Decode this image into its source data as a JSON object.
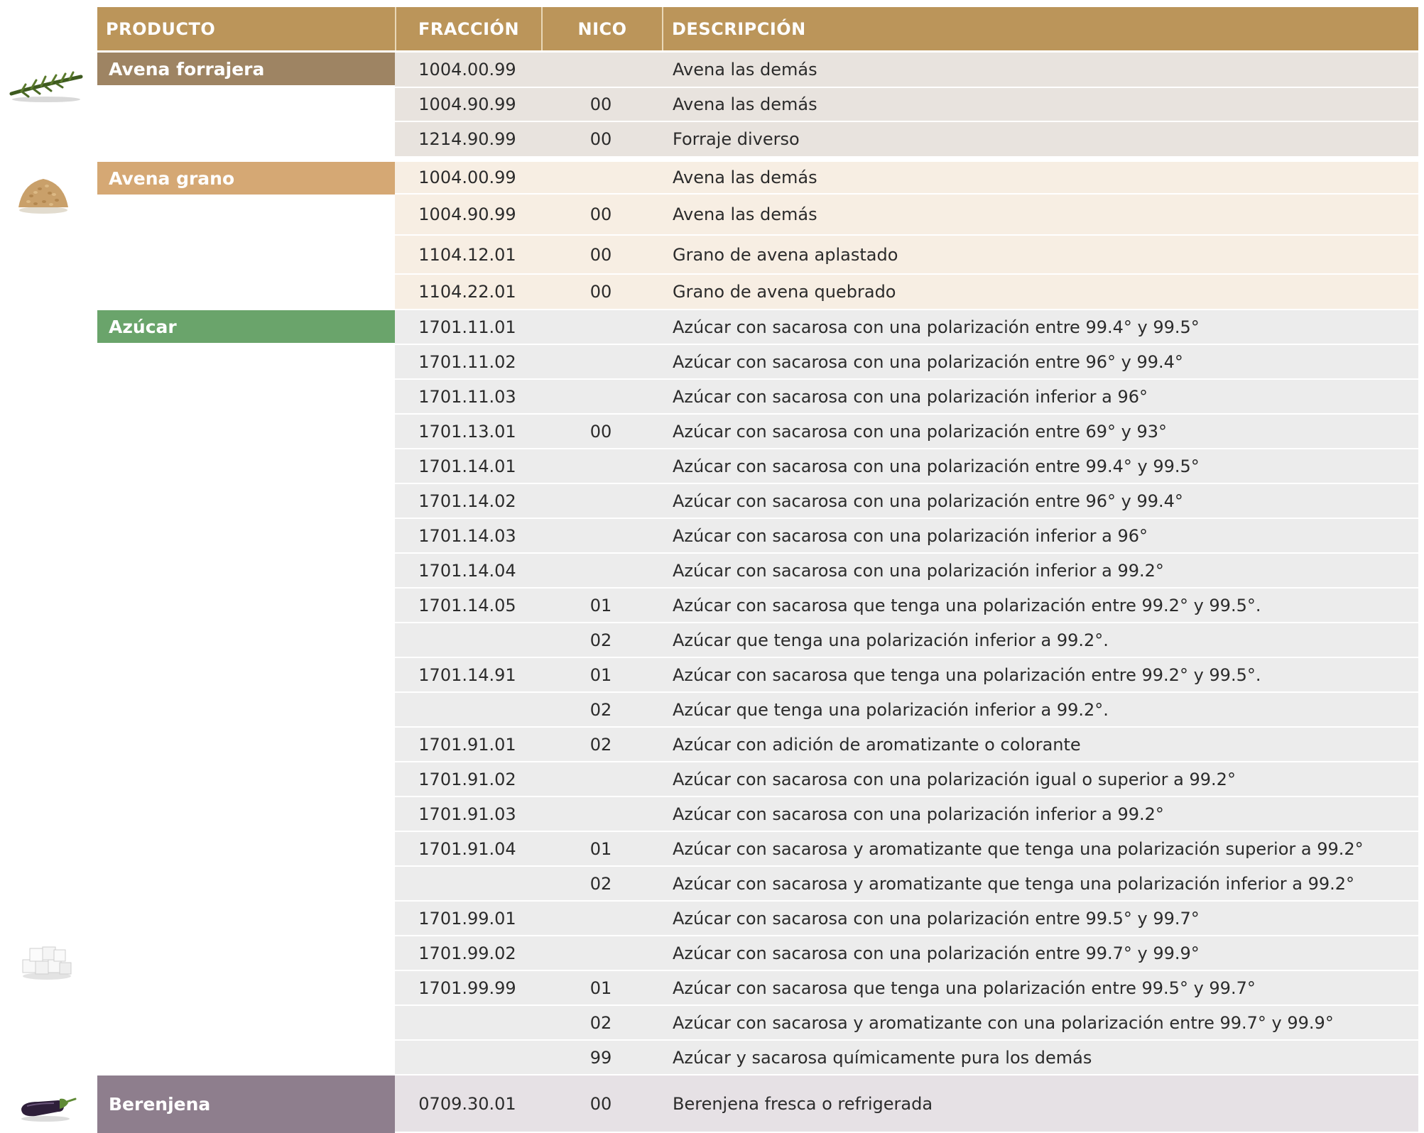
{
  "header": {
    "producto": "PRODUCTO",
    "fraccion": "FRACCIÓN",
    "nico": "NICO",
    "descripcion": "DESCRIPCIÓN"
  },
  "colors": {
    "header": "#bb955a",
    "avena_forrajera_label": "#9e8463",
    "avena_forrajera_rows": "#e8e3de",
    "avena_grano_label": "#d5a874",
    "avena_grano_rows": "#f7eee3",
    "azucar_label": "#6aa46b",
    "azucar_rows": "#ececec",
    "berenjena_label": "#8e7e8d",
    "berenjena_rows": "#e6e1e5"
  },
  "products": [
    {
      "name": "Avena forrajera",
      "icon": "forage-oat-icon",
      "rows": [
        {
          "fraccion": "1004.00.99",
          "nico": "",
          "descripcion": "Avena las demás"
        },
        {
          "fraccion": "1004.90.99",
          "nico": "00",
          "descripcion": "Avena las demás"
        },
        {
          "fraccion": "1214.90.99",
          "nico": "00",
          "descripcion": "Forraje diverso"
        }
      ]
    },
    {
      "name": "Avena grano",
      "icon": "oat-grain-icon",
      "rows": [
        {
          "fraccion": "1004.00.99",
          "nico": "",
          "descripcion": "Avena las demás"
        },
        {
          "fraccion": "1004.90.99",
          "nico": "00",
          "descripcion": "Avena las demás"
        },
        {
          "fraccion": "1104.12.01",
          "nico": "00",
          "descripcion": "Grano de avena aplastado"
        },
        {
          "fraccion": "1104.22.01",
          "nico": "00",
          "descripcion": "Grano de avena quebrado"
        }
      ]
    },
    {
      "name": "Azúcar",
      "icon": "sugar-cubes-icon",
      "rows": [
        {
          "fraccion": "1701.11.01",
          "nico": "",
          "descripcion": "Azúcar con sacarosa con una polarización entre 99.4° y 99.5°"
        },
        {
          "fraccion": "1701.11.02",
          "nico": "",
          "descripcion": "Azúcar con sacarosa con una polarización entre 96° y 99.4°"
        },
        {
          "fraccion": "1701.11.03",
          "nico": "",
          "descripcion": "Azúcar con sacarosa con una polarización inferior a 96°"
        },
        {
          "fraccion": "1701.13.01",
          "nico": "00",
          "descripcion": "Azúcar con sacarosa con una polarización entre 69° y 93°"
        },
        {
          "fraccion": "1701.14.01",
          "nico": "",
          "descripcion": "Azúcar con sacarosa con una polarización entre 99.4° y 99.5°"
        },
        {
          "fraccion": "1701.14.02",
          "nico": "",
          "descripcion": "Azúcar con sacarosa con una polarización entre 96° y 99.4°"
        },
        {
          "fraccion": "1701.14.03",
          "nico": "",
          "descripcion": "Azúcar con sacarosa con una polarización inferior a 96°"
        },
        {
          "fraccion": "1701.14.04",
          "nico": "",
          "descripcion": "Azúcar con sacarosa con una polarización inferior a 99.2°"
        },
        {
          "fraccion": "1701.14.05",
          "nico": "01",
          "descripcion": "Azúcar con sacarosa que tenga una polarización entre 99.2° y 99.5°."
        },
        {
          "fraccion": "",
          "nico": "02",
          "descripcion": "Azúcar que tenga una polarización inferior a 99.2°."
        },
        {
          "fraccion": "1701.14.91",
          "nico": "01",
          "descripcion": "Azúcar con sacarosa que tenga una polarización entre 99.2° y 99.5°."
        },
        {
          "fraccion": "",
          "nico": "02",
          "descripcion": "Azúcar que tenga una polarización inferior a 99.2°."
        },
        {
          "fraccion": "1701.91.01",
          "nico": "02",
          "descripcion": "Azúcar con adición de aromatizante o colorante"
        },
        {
          "fraccion": "1701.91.02",
          "nico": "",
          "descripcion": "Azúcar con sacarosa con una polarización igual o superior a 99.2°"
        },
        {
          "fraccion": "1701.91.03",
          "nico": "",
          "descripcion": "Azúcar con sacarosa con una polarización inferior a 99.2°"
        },
        {
          "fraccion": "1701.91.04",
          "nico": "01",
          "descripcion": "Azúcar con sacarosa y aromatizante que tenga una polarización superior a 99.2°"
        },
        {
          "fraccion": "",
          "nico": "02",
          "descripcion": "Azúcar con sacarosa y aromatizante que tenga una polarización inferior a 99.2°"
        },
        {
          "fraccion": "1701.99.01",
          "nico": "",
          "descripcion": "Azúcar con sacarosa con una polarización entre 99.5° y 99.7°"
        },
        {
          "fraccion": "1701.99.02",
          "nico": "",
          "descripcion": "Azúcar con sacarosa con una polarización entre 99.7° y 99.9°"
        },
        {
          "fraccion": "1701.99.99",
          "nico": "01",
          "descripcion": "Azúcar con sacarosa que tenga una polarización entre 99.5° y 99.7°"
        },
        {
          "fraccion": "",
          "nico": "02",
          "descripcion": "Azúcar con sacarosa y aromatizante con una polarización entre 99.7° y 99.9°"
        },
        {
          "fraccion": "",
          "nico": "99",
          "descripcion": "Azúcar y sacarosa químicamente pura los demás"
        }
      ]
    },
    {
      "name": "Berenjena",
      "icon": "eggplant-icon",
      "rows": [
        {
          "fraccion": "0709.30.01",
          "nico": "00",
          "descripcion": "Berenjena fresca o refrigerada"
        }
      ]
    }
  ]
}
